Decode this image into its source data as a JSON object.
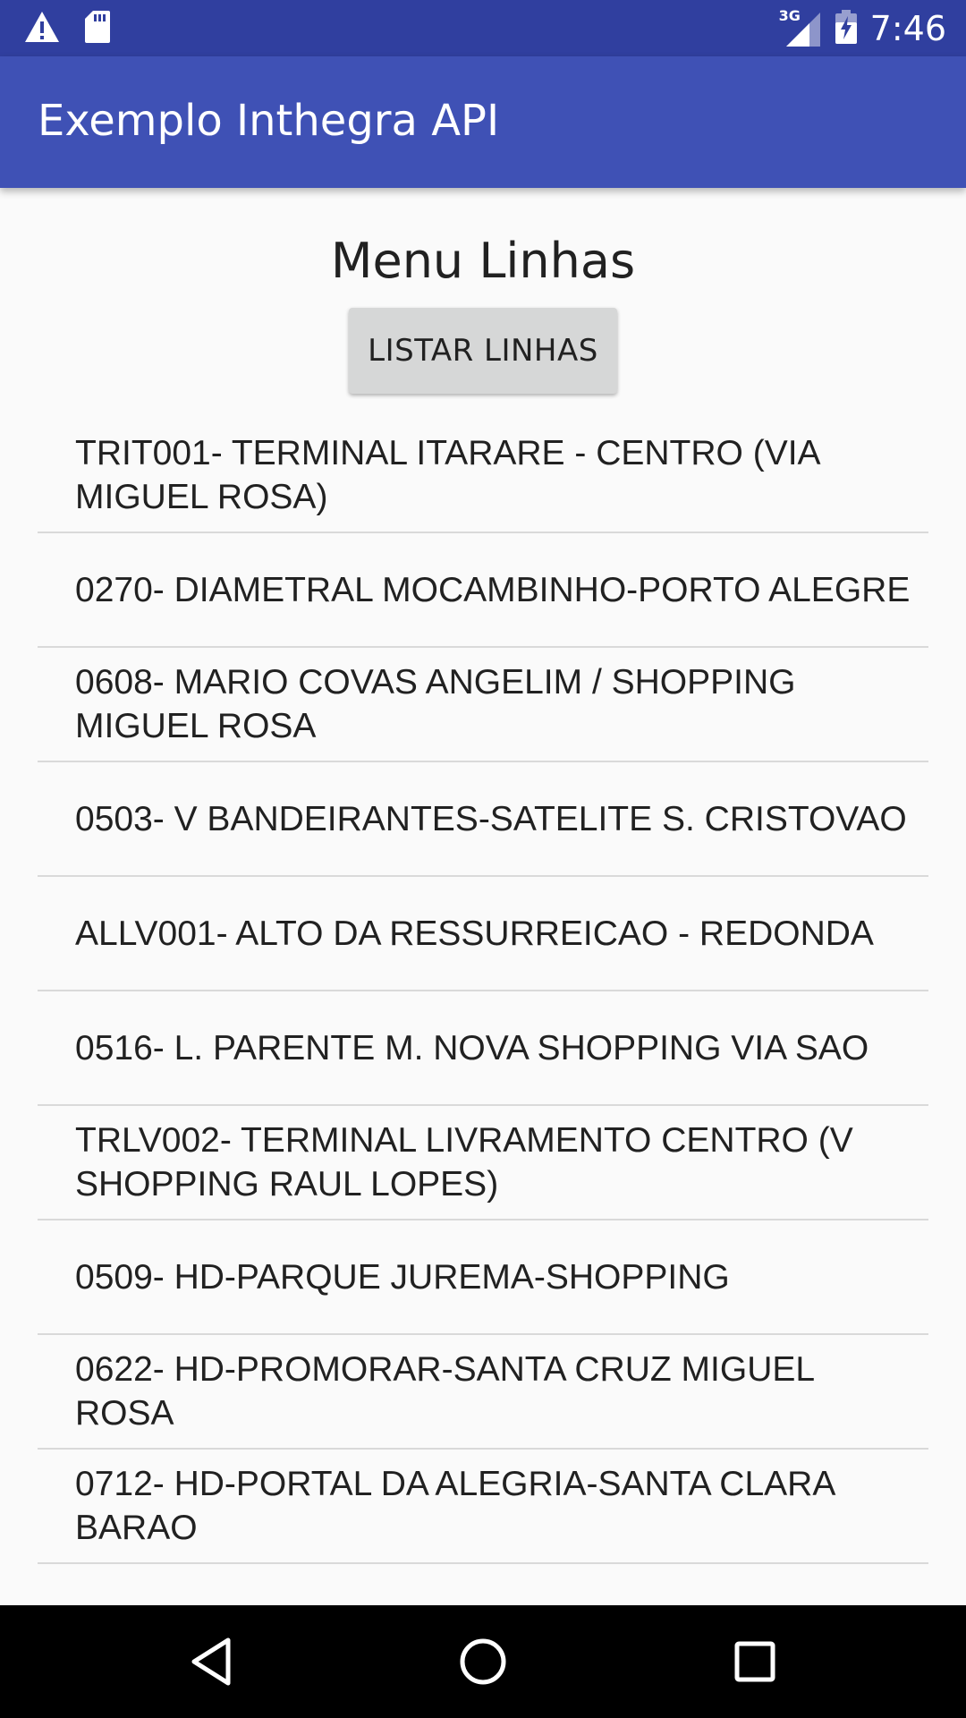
{
  "status_bar": {
    "network_type": "3G",
    "time": "7:46",
    "icons": [
      "warning-icon",
      "sd-card-icon",
      "signal-icon",
      "battery-charging-icon"
    ]
  },
  "app_bar": {
    "title": "Exemplo Inthegra API"
  },
  "main": {
    "heading": "Menu Linhas",
    "button_label": "LISTAR LINHAS",
    "lines": [
      "TRIT001- TERMINAL ITARARE - CENTRO (VIA MIGUEL ROSA)",
      "0270- DIAMETRAL MOCAMBINHO-PORTO ALEGRE",
      "0608- MARIO COVAS ANGELIM / SHOPPING MIGUEL ROSA",
      "0503- V BANDEIRANTES-SATELITE S. CRISTOVAO",
      "ALLV001- ALTO DA RESSURREICAO - REDONDA",
      "0516- L. PARENTE M. NOVA SHOPPING VIA SAO",
      "TRLV002- TERMINAL LIVRAMENTO CENTRO (V SHOPPING RAUL LOPES)",
      "0509- HD-PARQUE JUREMA-SHOPPING",
      "0622- HD-PROMORAR-SANTA CRUZ MIGUEL ROSA",
      "0712- HD-PORTAL DA ALEGRIA-SANTA CLARA BARAO"
    ]
  },
  "nav_bar": {
    "icons": [
      "back-icon",
      "home-icon",
      "recents-icon"
    ]
  },
  "colors": {
    "status_bar": "#303f9f",
    "app_bar": "#3f51b5",
    "background": "#fafafa",
    "button": "#d6d7d7"
  }
}
